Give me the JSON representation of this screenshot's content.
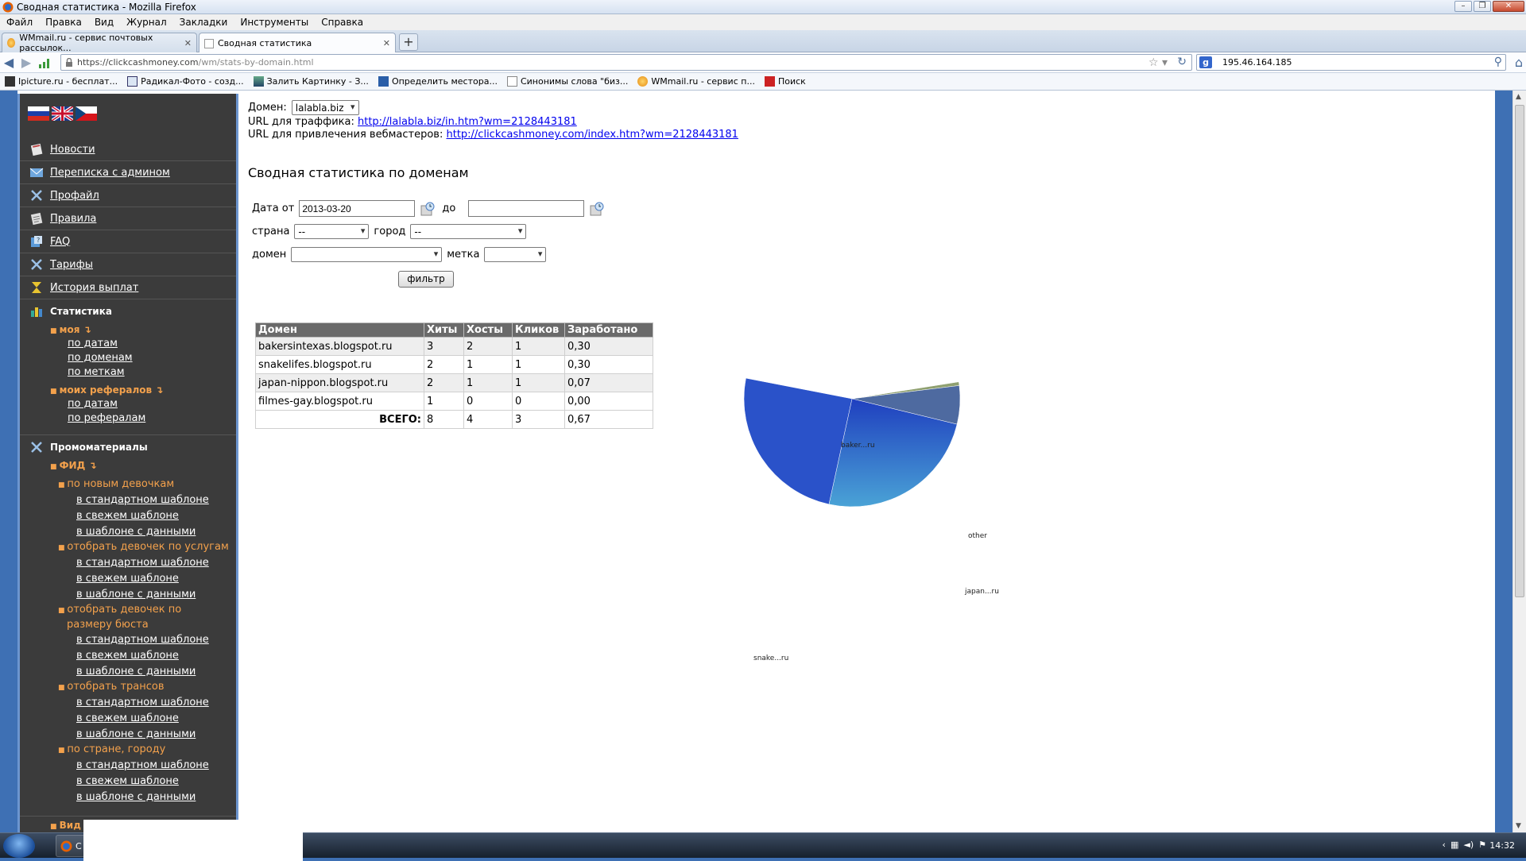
{
  "window": {
    "title": "Сводная статистика - Mozilla Firefox"
  },
  "menubar": [
    "Файл",
    "Правка",
    "Вид",
    "Журнал",
    "Закладки",
    "Инструменты",
    "Справка"
  ],
  "tabs": [
    {
      "label": "WMmail.ru - сервис почтовых рассылок..."
    },
    {
      "label": "Сводная статистика"
    }
  ],
  "nav": {
    "url_host": "https://clickcashmoney.com",
    "url_path": "/wm/stats-by-domain.html",
    "search_value": "195.46.164.185"
  },
  "bookmarks": [
    "Ipicture.ru - бесплат...",
    "Радикал-Фото - созд...",
    "Залить Картинку - З...",
    "Определить местора...",
    "Синонимы слова \"биз...",
    "WMmail.ru - сервис п...",
    "Поиск"
  ],
  "sidebar": {
    "items": [
      {
        "label": "Новости"
      },
      {
        "label": "Переписка с админом"
      },
      {
        "label": "Профайл"
      },
      {
        "label": "Правила"
      },
      {
        "label": "FAQ"
      },
      {
        "label": "Тарифы"
      },
      {
        "label": "История выплат"
      }
    ],
    "stats_header": "Статистика",
    "my": "моя ↴",
    "my_links": [
      "по датам",
      "по доменам",
      "по меткам"
    ],
    "refs": "моих рефералов ↴",
    "refs_links": [
      "по датам",
      "по рефералам"
    ],
    "promo_header": "Промоматериалы",
    "feed": "ФИД ↴",
    "groups": [
      {
        "title": "по новым девочкам",
        "links": [
          "в стандартном шаблоне",
          "в свежем шаблоне",
          "в шаблоне с данными"
        ]
      },
      {
        "title": "отобрать девочек по услугам",
        "links": [
          "в стандартном шаблоне",
          "в свежем шаблоне",
          "в шаблоне с данными"
        ]
      },
      {
        "title": "отобрать девочек по размеру бюста",
        "links": [
          "в стандартном шаблоне",
          "в свежем шаблоне",
          "в шаблоне с данными"
        ]
      },
      {
        "title": "отобрать трансов",
        "links": [
          "в стандартном шаблоне",
          "в свежем шаблоне",
          "в шаблоне с данными"
        ]
      },
      {
        "title": "по стране, городу",
        "links": [
          "в стандартном шаблоне",
          "в свежем шаблоне",
          "в шаблоне с данными"
        ]
      }
    ],
    "cut_item": "Вид"
  },
  "content": {
    "domain_label": "Домен:",
    "domain_value": "lalabla.biz",
    "traffic_url_label": "URL для траффика:",
    "traffic_url": "http://lalabla.biz/in.htm?wm=2128443181",
    "webmaster_url_label": "URL для привлечения вебмастеров:",
    "webmaster_url": "http://clickcashmoney.com/index.htm?wm=2128443181",
    "title": "Сводная статистика по доменам",
    "filter": {
      "date_from_label": "Дата от",
      "date_from_value": "2013-03-20",
      "date_to_label": "до",
      "date_to_value": "",
      "country_label": "страна",
      "country_value": "--",
      "city_label": "город",
      "city_value": "--",
      "domain_label": "домен",
      "domain_value": "",
      "tag_label": "метка",
      "tag_value": "",
      "button": "фильтр"
    },
    "table": {
      "headers": [
        "Домен",
        "Хиты",
        "Хосты",
        "Кликов",
        "Заработано"
      ],
      "rows": [
        [
          "bakersintexas.blogspot.ru",
          "3",
          "2",
          "1",
          "0,30"
        ],
        [
          "snakelifes.blogspot.ru",
          "2",
          "1",
          "1",
          "0,30"
        ],
        [
          "japan-nippon.blogspot.ru",
          "2",
          "1",
          "1",
          "0,07"
        ],
        [
          "filmes-gay.blogspot.ru",
          "1",
          "0",
          "0",
          "0,00"
        ]
      ],
      "total": [
        "ВСЕГО:",
        "8",
        "4",
        "3",
        "0,67"
      ]
    }
  },
  "chart_data": {
    "type": "pie",
    "labels": [
      "baker...ru",
      "snake...ru",
      "japan...ru",
      "other"
    ],
    "values": [
      0.3,
      0.3,
      0.07,
      0.0
    ],
    "colors": [
      "#2a52c9",
      "#3e8fd0",
      "#4e6aa0",
      "#8fa070"
    ]
  },
  "taskbar": {
    "clock": "14:32"
  }
}
